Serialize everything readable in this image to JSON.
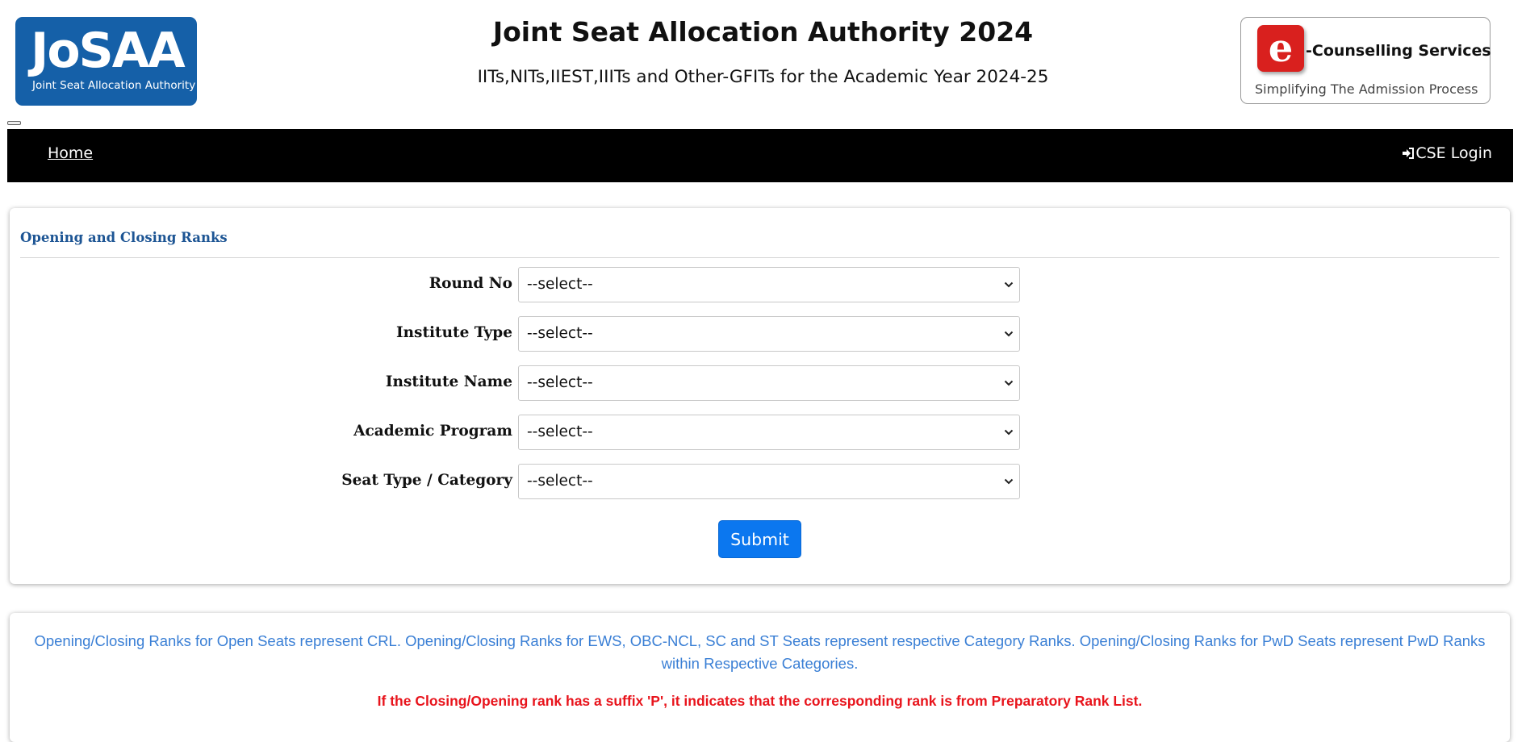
{
  "header": {
    "logo_left": {
      "big": "JoSAA",
      "small": "Joint Seat Allocation Authority"
    },
    "title": "Joint Seat Allocation Authority 2024",
    "subtitle": "IITs,NITs,IIEST,IIITs and Other-GFITs for the Academic Year 2024-25",
    "logo_right": {
      "letter": "e",
      "counselling": "-Counselling Services",
      "tagline": "Simplifying The Admission Process"
    }
  },
  "navbar": {
    "home_label": "Home",
    "login_label": "CSE Login",
    "login_icon": "sign-in-icon"
  },
  "form": {
    "heading": "Opening and Closing Ranks",
    "fields": [
      {
        "label": "Round No",
        "value": "--select--"
      },
      {
        "label": "Institute Type",
        "value": "--select--"
      },
      {
        "label": "Institute Name",
        "value": "--select--"
      },
      {
        "label": "Academic Program",
        "value": "--select--"
      },
      {
        "label": "Seat Type / Category",
        "value": "--select--"
      }
    ],
    "submit_label": "Submit"
  },
  "info": {
    "note": "Opening/Closing Ranks for Open Seats represent CRL. Opening/Closing Ranks for EWS, OBC-NCL, SC and ST Seats represent respective Category Ranks. Opening/Closing Ranks for PwD Seats represent PwD Ranks within Respective Categories.",
    "warning": "If the Closing/Opening rank has a suffix 'P', it indicates that the corresponding rank is from Preparatory Rank List."
  },
  "colors": {
    "brand_blue": "#1560a8",
    "navbar_bg": "#000000",
    "heading_blue": "#1d5594",
    "submit_blue": "#0b77ef",
    "info_blue": "#3a7fd5",
    "warning_red": "#e8141c",
    "ecounsel_red": "#d9201e"
  }
}
